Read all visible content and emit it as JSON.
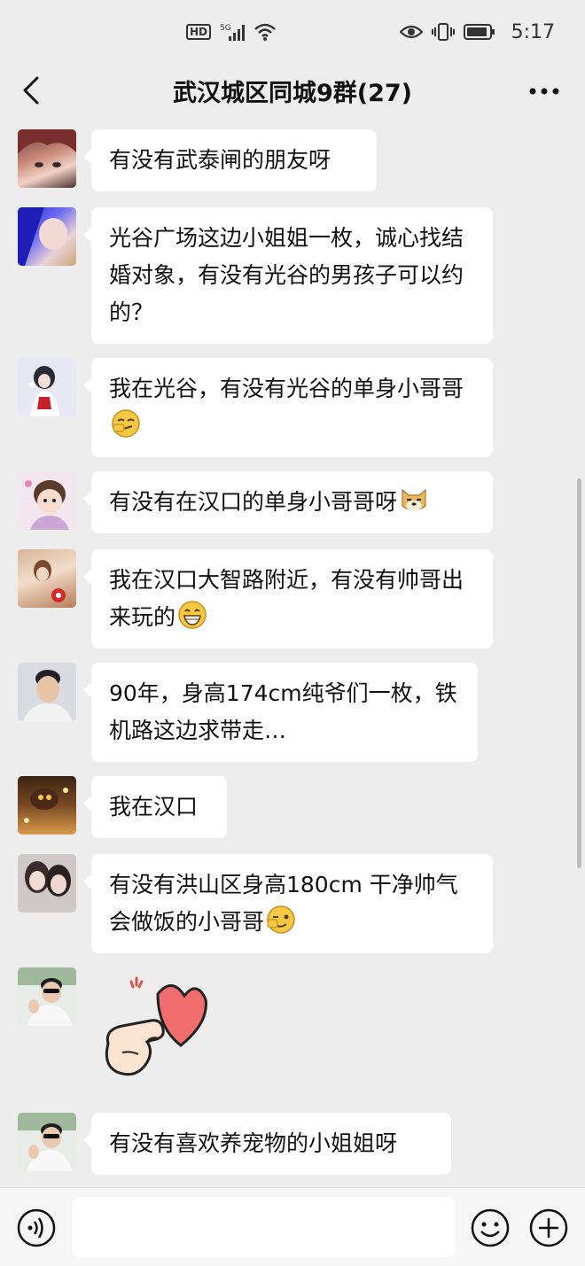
{
  "status_bar": {
    "hd": "HD",
    "network": "5G",
    "time": "5:17"
  },
  "header": {
    "title": "武汉城区同城9群(27)"
  },
  "messages": [
    {
      "text": "有没有武泰闸的朋友呀",
      "avatar": "avatar-anime-boy"
    },
    {
      "text": "光谷广场这边小姐姐一枚，诚心找结婚对象，有没有光谷的男孩子可以约的？",
      "avatar": "avatar-blue-hair"
    },
    {
      "text": "我在光谷，有没有光谷的单身小哥哥",
      "emoji": "smirk-emoji",
      "avatar": "avatar-illustration-girl"
    },
    {
      "text": "有没有在汉口的单身小哥哥呀",
      "emoji": "doge-emoji",
      "avatar": "avatar-baby-girl"
    },
    {
      "text": "我在汉口大智路附近，有没有帅哥出来玩的",
      "emoji": "grin-emoji",
      "avatar": "avatar-photo-girl"
    },
    {
      "text": "90年，身高174cm纯爷们一枚，铁机路这边求带走…",
      "avatar": "avatar-man"
    },
    {
      "text": "我在汉口",
      "avatar": "avatar-cake"
    },
    {
      "text": "有没有洪山区身高180cm  干净帅气会做饭的小哥哥",
      "emoji": "wink-emoji",
      "avatar": "avatar-two-girls"
    },
    {
      "sticker": "heart-hand-sticker",
      "avatar": "avatar-sunglasses-man"
    },
    {
      "text": "有没有喜欢养宠物的小姐姐呀",
      "avatar": "avatar-sunglasses-man"
    }
  ],
  "colors": {
    "background": "#ededed",
    "bubble": "#ffffff",
    "input_bar": "#f6f6f6"
  }
}
